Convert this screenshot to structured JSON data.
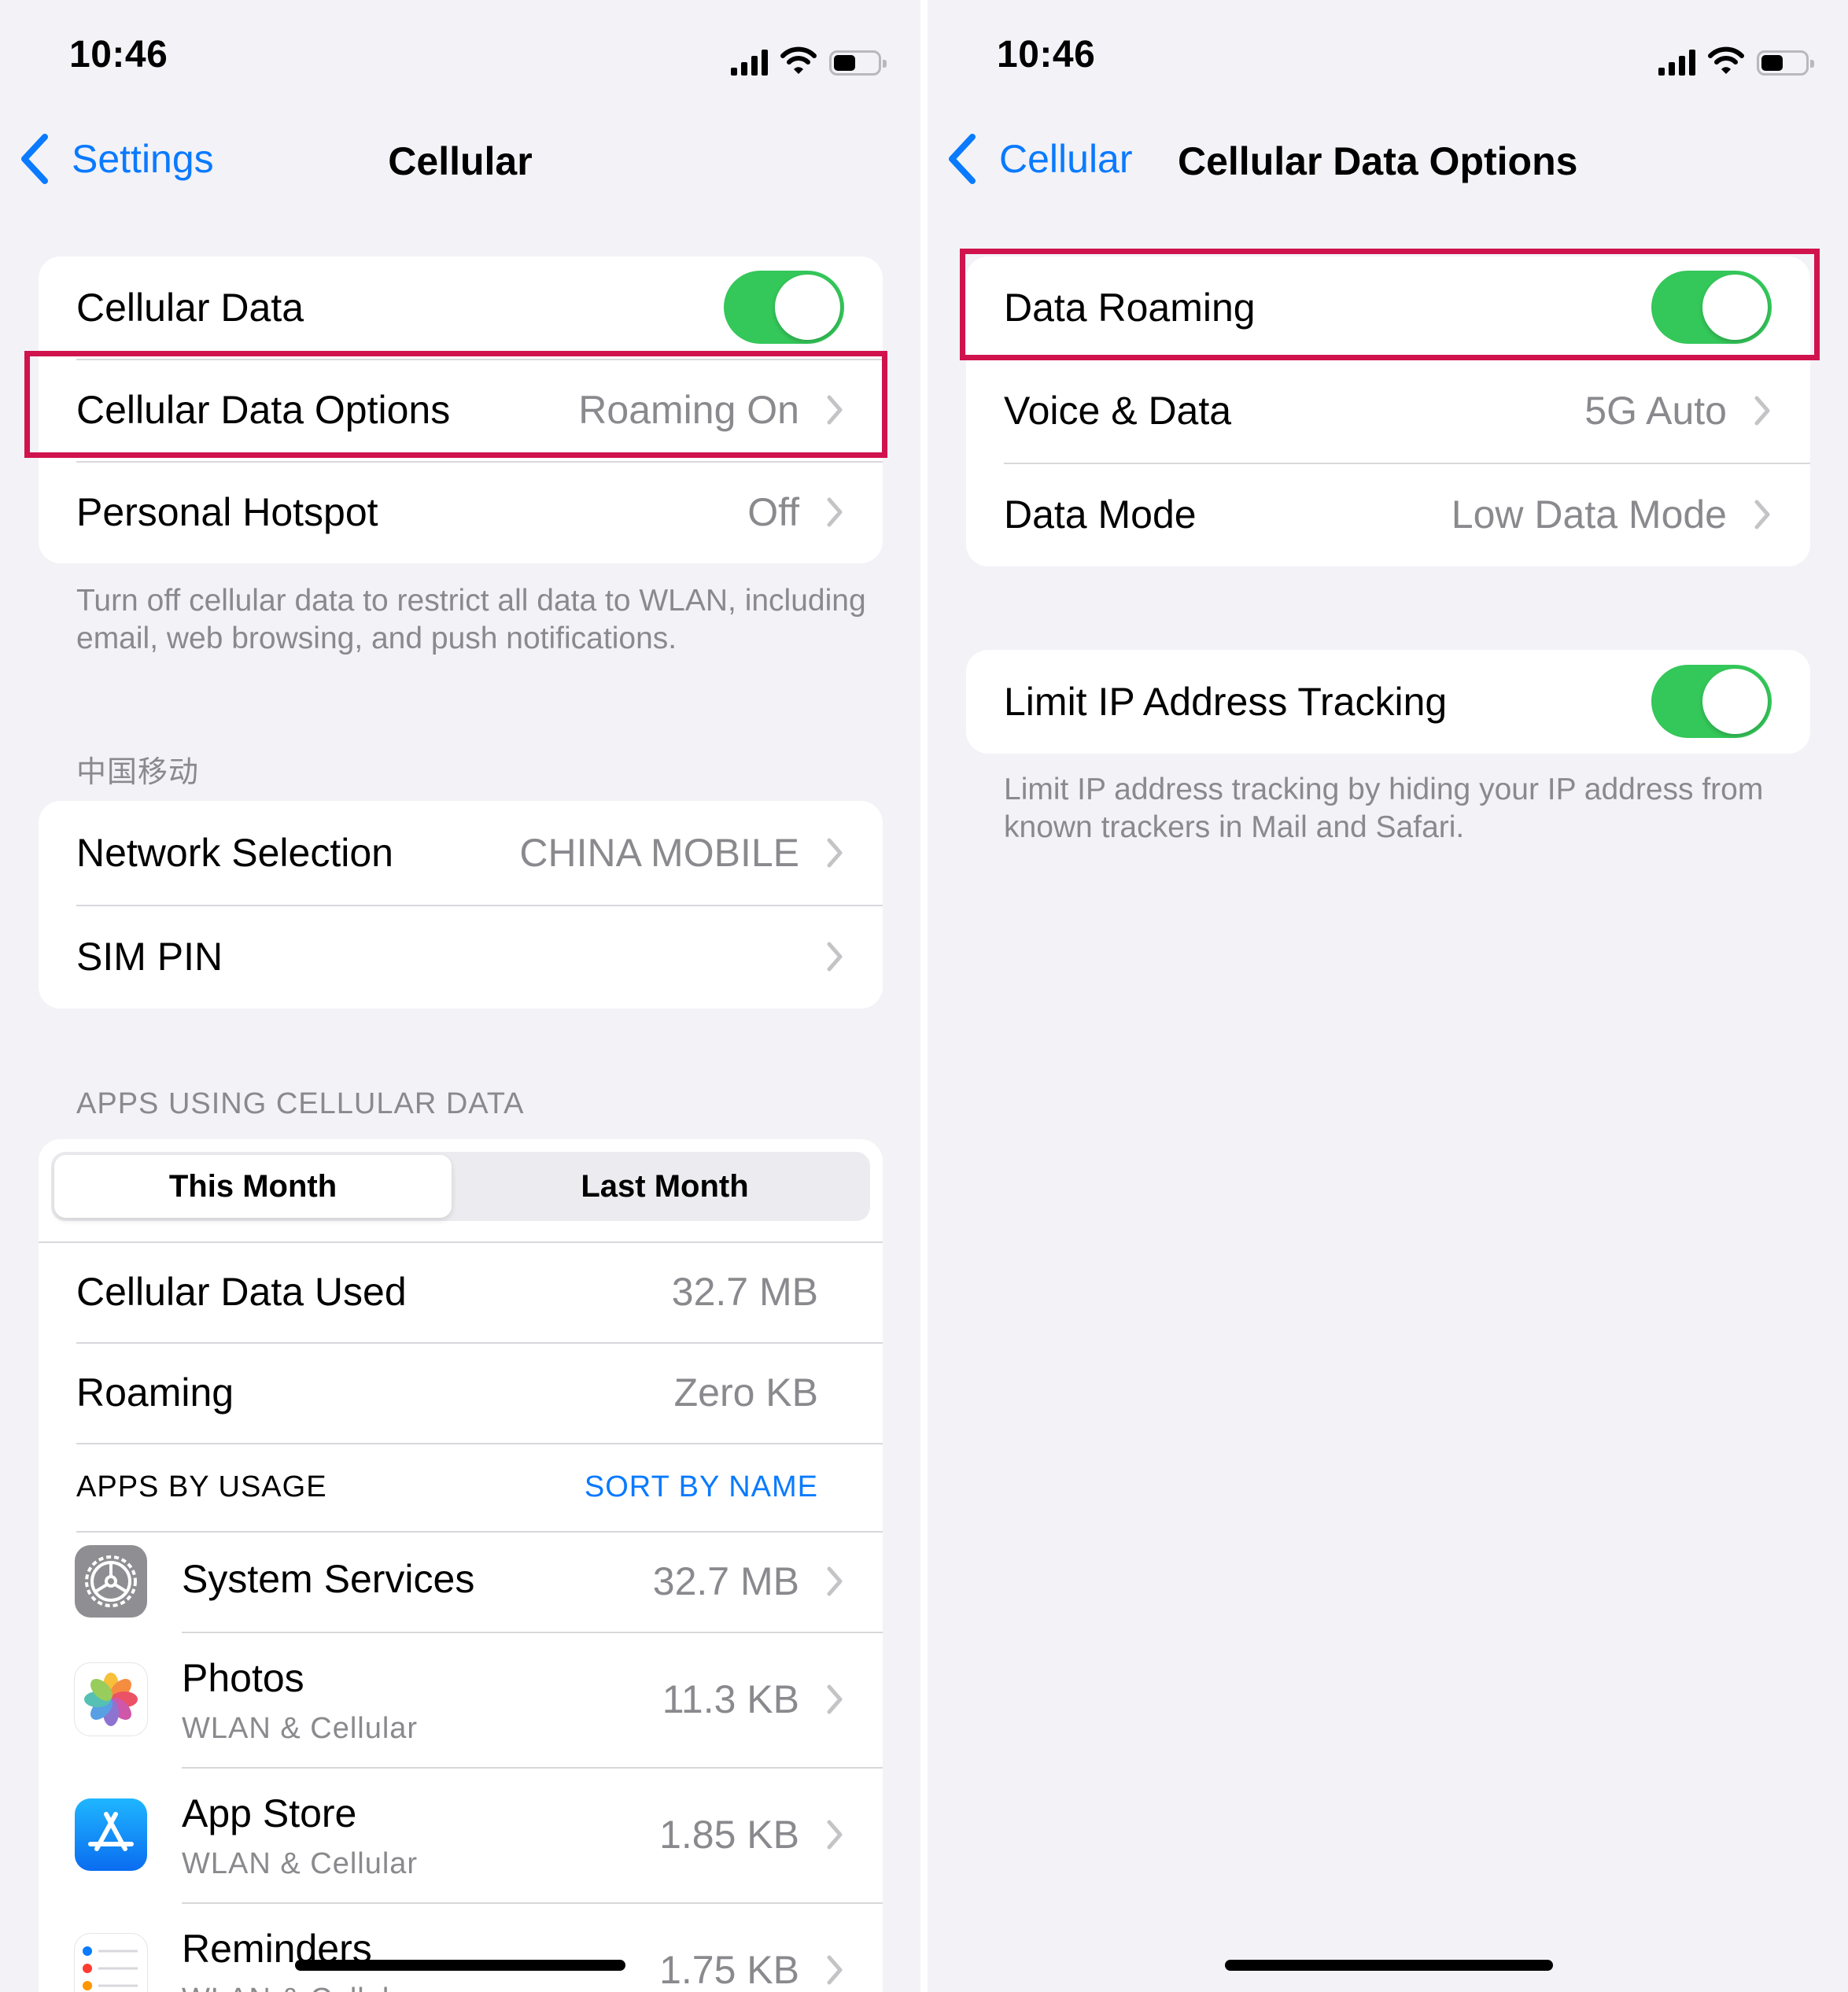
{
  "left": {
    "status": {
      "time": "10:46"
    },
    "nav": {
      "back_label": "Settings",
      "title": "Cellular"
    },
    "group1": {
      "cellular_data_label": "Cellular Data",
      "options_label": "Cellular Data Options",
      "options_value": "Roaming On",
      "hotspot_label": "Personal Hotspot",
      "hotspot_value": "Off"
    },
    "footer1": "Turn off cellular data to restrict all data to WLAN, including email, web browsing, and push notifications.",
    "carrier_header": "中国移动",
    "group2": {
      "network_label": "Network Selection",
      "network_value": "CHINA MOBILE",
      "sim_label": "SIM PIN"
    },
    "apps_header": "APPS USING CELLULAR DATA",
    "segments": {
      "this_month": "This Month",
      "last_month": "Last Month"
    },
    "usage": {
      "used_label": "Cellular Data Used",
      "used_value": "32.7 MB",
      "roaming_label": "Roaming",
      "roaming_value": "Zero KB",
      "apps_by_usage": "APPS BY USAGE",
      "sort_by_name": "SORT BY NAME"
    },
    "apps": [
      {
        "name": "System Services",
        "subtitle": "",
        "usage": "32.7 MB",
        "icon": "gear-icon"
      },
      {
        "name": "Photos",
        "subtitle": "WLAN & Cellular",
        "usage": "11.3 KB",
        "icon": "photos-icon"
      },
      {
        "name": "App Store",
        "subtitle": "WLAN & Cellular",
        "usage": "1.85 KB",
        "icon": "app-store-icon"
      },
      {
        "name": "Reminders",
        "subtitle": "WLAN & Cellular",
        "usage": "1.75 KB",
        "icon": "reminders-icon"
      }
    ]
  },
  "right": {
    "status": {
      "time": "10:46"
    },
    "nav": {
      "back_label": "Cellular",
      "title": "Cellular Data Options"
    },
    "group1": {
      "roaming_label": "Data Roaming",
      "voice_label": "Voice & Data",
      "voice_value": "5G Auto",
      "mode_label": "Data Mode",
      "mode_value": "Low Data Mode"
    },
    "group2": {
      "limit_ip_label": "Limit IP Address Tracking"
    },
    "footer": "Limit IP address tracking by hiding your IP address from known trackers in Mail and Safari."
  },
  "colors": {
    "accent": "#0a7aff",
    "toggle_on": "#34c759",
    "highlight": "#d0134d",
    "background": "#f2f2f7",
    "secondary_text": "#8a8a8e"
  },
  "toggles": {
    "cellular_data": true,
    "data_roaming": true,
    "limit_ip_tracking": true
  },
  "battery_level": 0.45
}
